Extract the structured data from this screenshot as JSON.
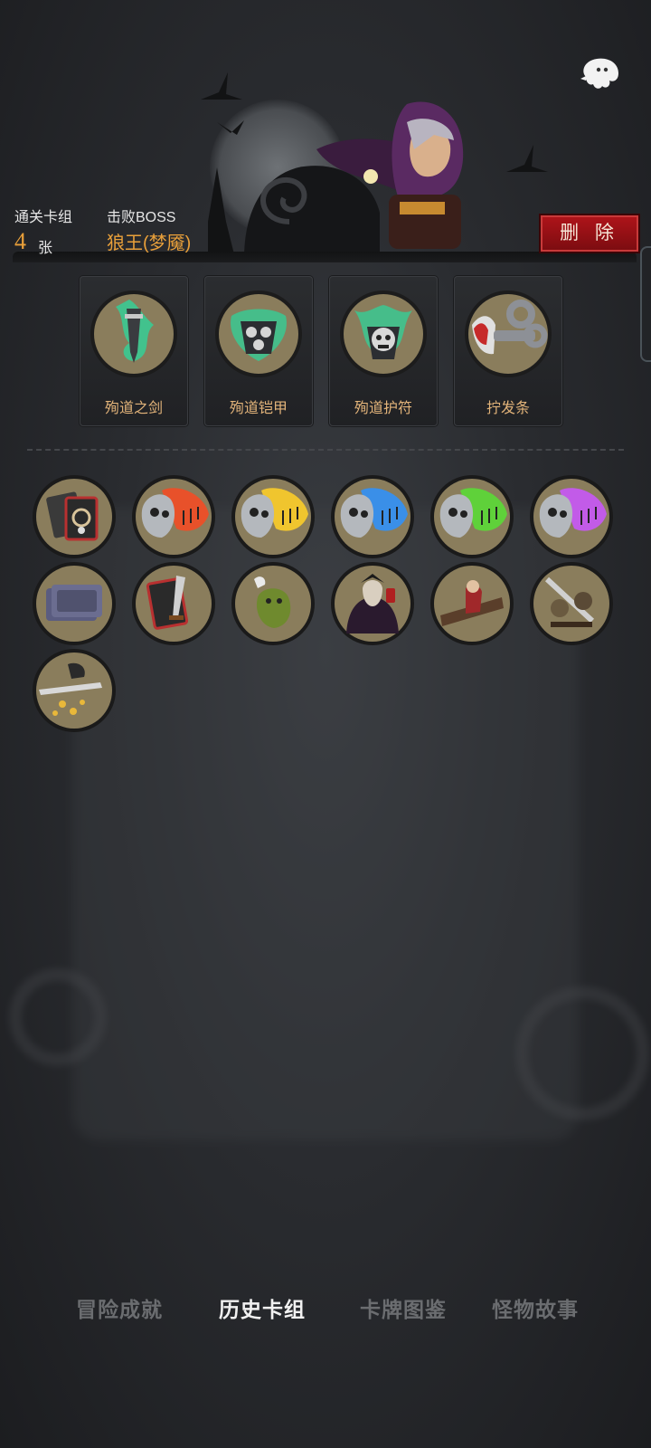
{
  "header": {
    "cards_label": "通关卡组",
    "cards_count": "4",
    "cards_unit": "张",
    "boss_label": "击败BOSS",
    "boss_name": "狼王(梦魇)",
    "delete_label": "删 除"
  },
  "equipment": [
    {
      "name": "殉道之剑",
      "icon": "martyr-sword-icon"
    },
    {
      "name": "殉道铠甲",
      "icon": "martyr-armor-icon"
    },
    {
      "name": "殉道护符",
      "icon": "martyr-amulet-icon"
    },
    {
      "name": "拧发条",
      "icon": "wind-up-key-icon"
    }
  ],
  "relics": [
    {
      "icon": "card-deck-icon"
    },
    {
      "icon": "red-flame-skull-icon",
      "color": "#e8512a"
    },
    {
      "icon": "yellow-flame-skull-icon",
      "color": "#f0c52e"
    },
    {
      "icon": "blue-flame-skull-icon",
      "color": "#3a8fe8"
    },
    {
      "icon": "green-flame-skull-icon",
      "color": "#5fd13a"
    },
    {
      "icon": "purple-flame-skull-icon",
      "color": "#c25be8"
    },
    {
      "icon": "card-stack-icon"
    },
    {
      "icon": "sword-card-icon"
    },
    {
      "icon": "ghost-ogre-icon"
    },
    {
      "icon": "vampire-icon"
    },
    {
      "icon": "pirate-girl-icon"
    },
    {
      "icon": "warrior-battle-icon"
    },
    {
      "icon": "sword-coins-icon"
    }
  ],
  "tabs": [
    {
      "label": "冒险成就",
      "active": false
    },
    {
      "label": "历史卡组",
      "active": true
    },
    {
      "label": "卡牌图鉴",
      "active": false
    },
    {
      "label": "怪物故事",
      "active": false
    }
  ],
  "colors": {
    "accent_gold": "#e9a03a",
    "delete_red": "#b0141a",
    "equip_text": "#e3b47a",
    "medal_bg": "#8a7d5c"
  }
}
